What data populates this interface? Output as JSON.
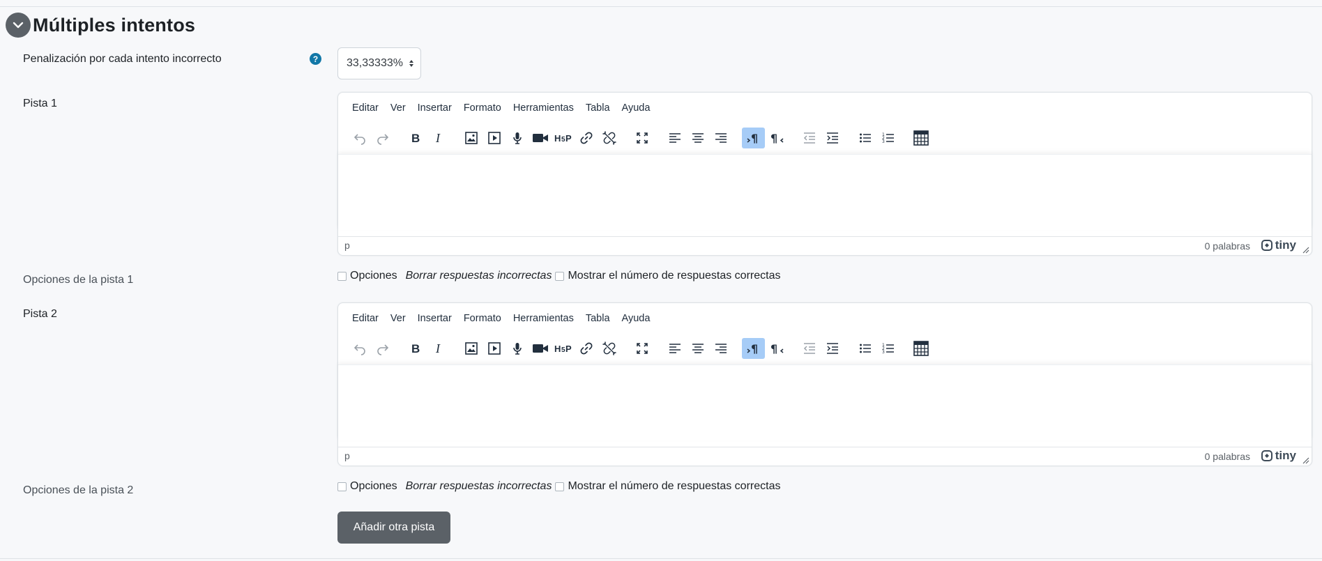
{
  "section": {
    "title": "Múltiples intentos",
    "collapse_icon": "chevron-down-icon"
  },
  "penalty": {
    "label": "Penalización por cada intento incorrecto",
    "help_icon": "help-icon",
    "help_glyph": "?",
    "value": "33,33333%"
  },
  "editor_menu": [
    "Editar",
    "Ver",
    "Insertar",
    "Formato",
    "Herramientas",
    "Tabla",
    "Ayuda"
  ],
  "toolbar_icons": [
    "undo-icon",
    "redo-icon",
    "bold-icon",
    "italic-icon",
    "image-icon",
    "media-icon",
    "microphone-icon",
    "video-camera-icon",
    "h5p-icon",
    "link-icon",
    "unlink-icon",
    "fullscreen-icon",
    "align-left-icon",
    "align-center-icon",
    "align-right-icon",
    "ltr-icon",
    "rtl-icon",
    "outdent-icon",
    "indent-icon",
    "bullet-list-icon",
    "numbered-list-icon",
    "table-icon"
  ],
  "hints": [
    {
      "label": "Pista 1",
      "path": "p",
      "word_count": "0 palabras",
      "brand": "tiny",
      "options_label": "Opciones de la pista 1",
      "options_text": "Opciones",
      "clear_incorrect": "Borrar respuestas incorrectas",
      "show_num_correct": "Mostrar el número de respuestas correctas"
    },
    {
      "label": "Pista 2",
      "path": "p",
      "word_count": "0 palabras",
      "brand": "tiny",
      "options_label": "Opciones de la pista 2",
      "options_text": "Opciones",
      "clear_incorrect": "Borrar respuestas incorrectas",
      "show_num_correct": "Mostrar el número de respuestas correctas"
    }
  ],
  "add_hint_button": "Añadir otra pista",
  "colors": {
    "accent": "#1177a7",
    "button_bg": "#5b6167",
    "active_tool": "#a6ccf7"
  }
}
